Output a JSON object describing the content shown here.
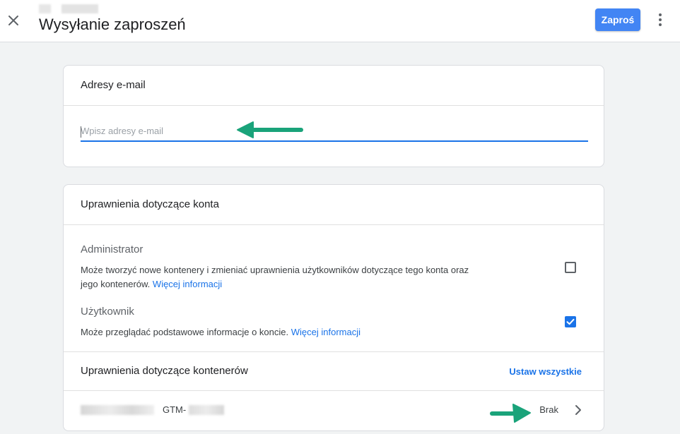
{
  "header": {
    "title": "Wysyłanie zaproszeń",
    "invite_label": "Zaproś",
    "close_icon": "close-icon",
    "more_icon": "more-vert-icon"
  },
  "email_section": {
    "title": "Adresy e-mail",
    "placeholder": "Wpisz adresy e-mail",
    "value": ""
  },
  "account_permissions": {
    "title": "Uprawnienia dotyczące konta",
    "roles": [
      {
        "name": "Administrator",
        "description": "Może tworzyć nowe kontenery i zmieniać uprawnienia użytkowników dotyczące tego konta oraz jego kontenerów.",
        "link": "Więcej informacji",
        "checked": false
      },
      {
        "name": "Użytkownik",
        "description": "Może przeglądać podstawowe informacje o koncie.",
        "link": "Więcej informacji",
        "checked": true
      }
    ]
  },
  "container_permissions": {
    "title": "Uprawnienia dotyczące kontenerów",
    "set_all_label": "Ustaw wszystkie",
    "rows": [
      {
        "id_prefix": "GTM-",
        "permission": "Brak"
      }
    ]
  },
  "colors": {
    "accent": "#1a73e8",
    "button": "#4285f4",
    "annotation_arrow": "#1aa37a",
    "background": "#f1f3f4"
  }
}
